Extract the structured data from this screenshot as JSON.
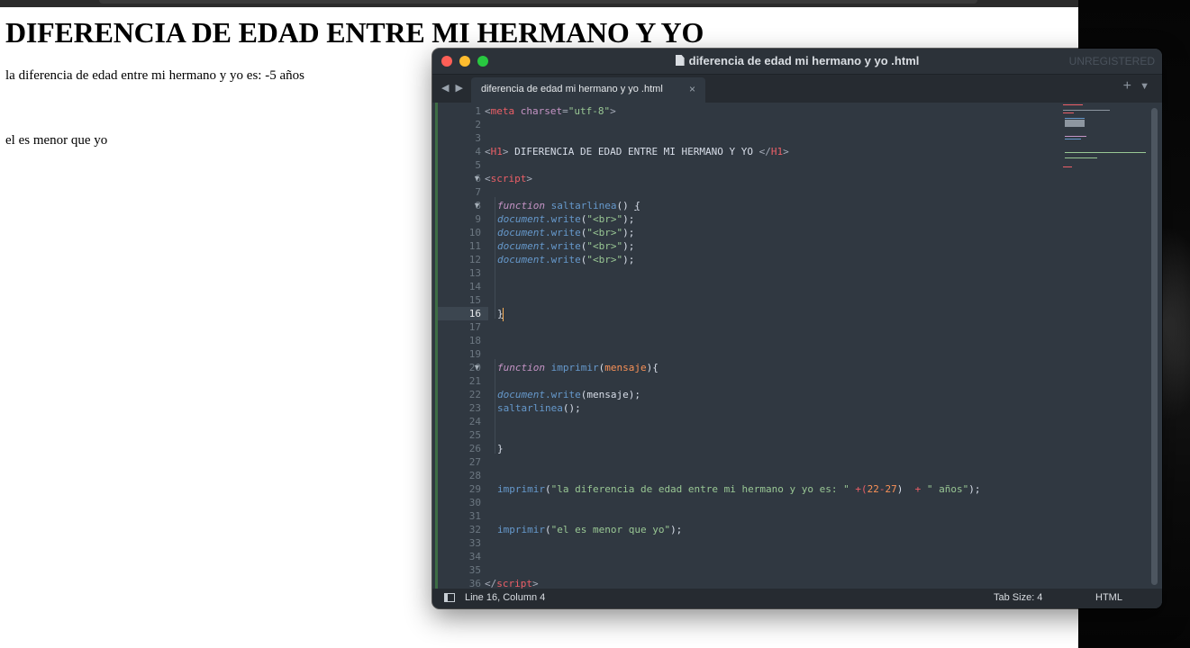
{
  "browser_page": {
    "heading": "DIFERENCIA DE EDAD ENTRE MI HERMANO Y YO",
    "line1": "la diferencia de edad entre mi hermano y yo es: -5 años",
    "line2": "el es menor que yo"
  },
  "editor": {
    "window_title": "diferencia de edad mi hermano y yo .html",
    "unregistered_label": "UNREGISTERED",
    "tab_label": "diferencia de edad mi hermano y yo .html",
    "tab_close": "×",
    "tab_plus": "+",
    "tab_menu": "▼",
    "nav_arrows": "◀ ▶",
    "current_line": 16,
    "line_numbers": [
      "1",
      "2",
      "3",
      "4",
      "5",
      "6",
      "7",
      "8",
      "9",
      "10",
      "11",
      "12",
      "13",
      "14",
      "15",
      "16",
      "17",
      "18",
      "19",
      "20",
      "21",
      "22",
      "23",
      "24",
      "25",
      "26",
      "27",
      "28",
      "29",
      "30",
      "31",
      "32",
      "33",
      "34",
      "35",
      "36"
    ],
    "fold_markers": [
      "6",
      "8",
      "20"
    ],
    "code": {
      "l1": [
        "<",
        "meta",
        " ",
        "charset",
        "=",
        "\"utf-8\"",
        ">"
      ],
      "l4": [
        "<",
        "H1",
        ">",
        " DIFERENCIA DE EDAD ENTRE MI HERMANO Y YO ",
        "</",
        "H1",
        ">"
      ],
      "l6": [
        "<",
        "script",
        ">"
      ],
      "l8": [
        "function",
        " ",
        "saltarlinea",
        "() ",
        "{"
      ],
      "write": [
        "document",
        ".write",
        "(",
        "\"<br>\"",
        ");"
      ],
      "l16": [
        "}"
      ],
      "l20": [
        "function",
        " ",
        "imprimir",
        "(",
        "mensaje",
        "){"
      ],
      "l22": [
        "document",
        ".write",
        "(mensaje);"
      ],
      "l23": [
        "saltarlinea",
        "();"
      ],
      "l26": [
        "}"
      ],
      "l29": [
        "imprimir",
        "(",
        "\"la diferencia de edad entre mi hermano y yo es: \"",
        " +(",
        "22",
        "-",
        "27",
        ")  ",
        "+",
        " ",
        "\" años\"",
        ");"
      ],
      "l32": [
        "imprimir",
        "(",
        "\"el es menor que yo\"",
        ");"
      ],
      "l36": [
        "</",
        "script",
        ">"
      ]
    },
    "status": {
      "position": "Line 16, Column 4",
      "tab_size": "Tab Size: 4",
      "syntax": "HTML"
    }
  },
  "colors": {
    "editor_bg": "#303841",
    "tag": "#ec5f67",
    "string": "#99c794",
    "keyword": "#c594c5",
    "function": "#6699cc",
    "number": "#f99157"
  }
}
